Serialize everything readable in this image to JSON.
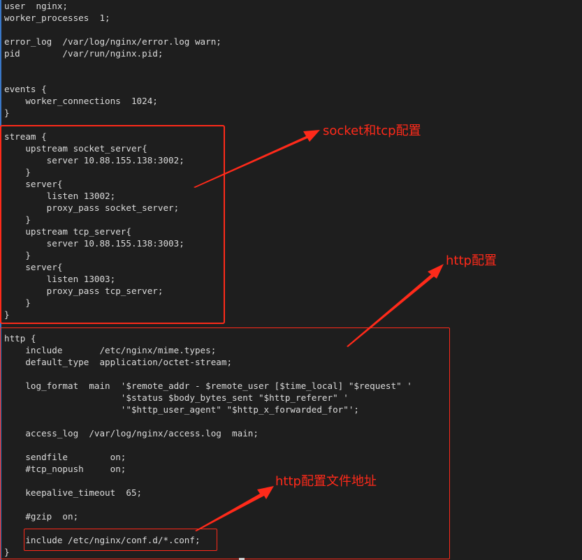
{
  "editor": {
    "lines": [
      "user  nginx;",
      "worker_processes  1;",
      "",
      "error_log  /var/log/nginx/error.log warn;",
      "pid        /var/run/nginx.pid;",
      "",
      "",
      "events {",
      "    worker_connections  1024;",
      "}",
      "",
      "stream {",
      "    upstream socket_server{",
      "        server 10.88.155.138:3002;",
      "    }",
      "    server{",
      "        listen 13002;",
      "        proxy_pass socket_server;",
      "    }",
      "    upstream tcp_server{",
      "        server 10.88.155.138:3003;",
      "    }",
      "    server{",
      "        listen 13003;",
      "        proxy_pass tcp_server;",
      "    }",
      "}",
      "",
      "http {",
      "    include       /etc/nginx/mime.types;",
      "    default_type  application/octet-stream;",
      "",
      "    log_format  main  '$remote_addr - $remote_user [$time_local] \"$request\" '",
      "                      '$status $body_bytes_sent \"$http_referer\" '",
      "                      '\"$http_user_agent\" \"$http_x_forwarded_for\"';",
      "",
      "    access_log  /var/log/nginx/access.log  main;",
      "",
      "    sendfile        on;",
      "    #tcp_nopush     on;",
      "",
      "    keepalive_timeout  65;",
      "",
      "    #gzip  on;",
      "",
      "    include /etc/nginx/conf.d/*.conf;",
      "}"
    ]
  },
  "annotations": {
    "stream_note": "socket和tcp配置",
    "http_note": "http配置",
    "include_note": "http配置文件地址",
    "color": "#ff2a1a"
  }
}
